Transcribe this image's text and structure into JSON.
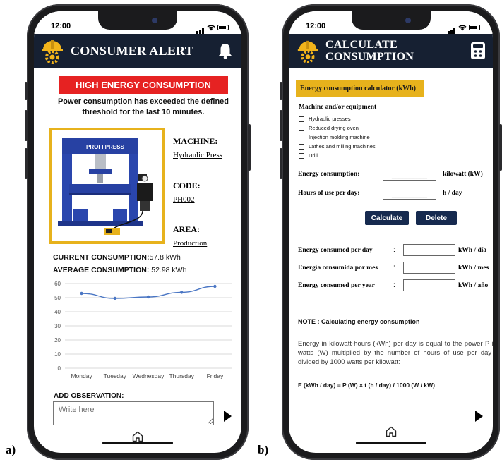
{
  "panels": {
    "a_label": "a)",
    "b_label": "b)"
  },
  "phone_a": {
    "status": {
      "time": "12:00"
    },
    "header": {
      "title": "CONSUMER ALERT",
      "logo_icon": "worker-helmet-gear-icon",
      "action_icon": "bell-icon"
    },
    "alert": {
      "banner": "HIGH ENERGY CONSUMPTION",
      "message": "Power consumption has exceeded the defined threshold for the last 10 minutes."
    },
    "machine": {
      "photo_label": "PROFI PRESS",
      "machine_label": "MACHINE:",
      "machine_value": "Hydraulic Press",
      "code_label": "CODE:",
      "code_value": "PH002",
      "area_label": "AREA:",
      "area_value": "Production"
    },
    "consumption": {
      "current_label": "CURRENT CONSUMPTION:",
      "current_value": "57.8 kWh",
      "average_label": "AVERAGE CONSUMPTION:",
      "average_value": "52.98 kWh"
    },
    "chart_data": {
      "type": "line",
      "categories": [
        "Monday",
        "Tuesday",
        "Wednesday",
        "Thursday",
        "Friday"
      ],
      "series": [
        {
          "values": [
            53,
            49.5,
            50.5,
            53.8,
            58
          ]
        }
      ],
      "yticks": [
        "0",
        "10",
        "20",
        "30",
        "40",
        "50",
        "60"
      ],
      "ylim": [
        0,
        60
      ],
      "grid": true,
      "line_color": "#4a76c4"
    },
    "observation": {
      "label": "ADD OBSERVATION:",
      "placeholder": "Write here"
    },
    "nav": {
      "home_icon": "home-icon",
      "next_icon": "next-arrow-icon"
    }
  },
  "phone_b": {
    "status": {
      "time": "12:00"
    },
    "header": {
      "title_line1": "CALCULATE",
      "title_line2": "CONSUMPTION",
      "logo_icon": "worker-helmet-gear-icon",
      "action_icon": "calculator-icon"
    },
    "section_label": "Energy consumption calculator (kWh)",
    "machines_title": "Machine and/or equipment",
    "machines": [
      "Hydraulic presses",
      "Reduced drying oven",
      "Injection molding machine",
      "Lathes and milling machines",
      "Drill"
    ],
    "inputs": {
      "energy_label": "Energy consumption:",
      "energy_unit": "kilowatt (kW)",
      "hours_label": "Hours of use per day:",
      "hours_unit": "h / day",
      "blank": "__________"
    },
    "buttons": {
      "calculate": "Calculate",
      "delete": "Delete"
    },
    "results": [
      {
        "label": "Energy consumed per day",
        "unit": "kWh / día"
      },
      {
        "label": "Energía consumida por mes",
        "unit": "kWh / mes"
      },
      {
        "label": "Energy consumed per year",
        "unit": "kWh / año"
      }
    ],
    "note": {
      "title": "NOTE : Calculating energy consumption",
      "body": "Energy in kilowatt-hours (kWh) per day is equal to the power P in watts (W) multiplied by the number of hours of use per day t divided by 1000 watts per kilowatt:",
      "formula": "E (kWh / day) = P (W) × t (h / day) / 1000 (W / kW)"
    },
    "nav": {
      "home_icon": "home-icon",
      "next_icon": "next-arrow-icon"
    }
  }
}
